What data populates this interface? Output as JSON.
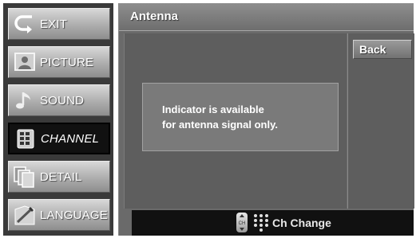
{
  "sidebar": {
    "items": [
      {
        "label": "EXIT",
        "icon": "exit-arrow-icon"
      },
      {
        "label": "PICTURE",
        "icon": "picture-icon"
      },
      {
        "label": "SOUND",
        "icon": "music-note-icon"
      },
      {
        "label": "CHANNEL",
        "icon": "channel-icon",
        "active": true
      },
      {
        "label": "DETAIL",
        "icon": "detail-icon"
      },
      {
        "label": "LANGUAGE",
        "icon": "language-icon"
      }
    ]
  },
  "header": {
    "title": "Antenna"
  },
  "main": {
    "message_lines": [
      "Indicator is available",
      "for antenna signal only."
    ],
    "back_label": "Back"
  },
  "footer": {
    "ch_button_glyph": "CH",
    "hint_label": "Ch Change"
  }
}
